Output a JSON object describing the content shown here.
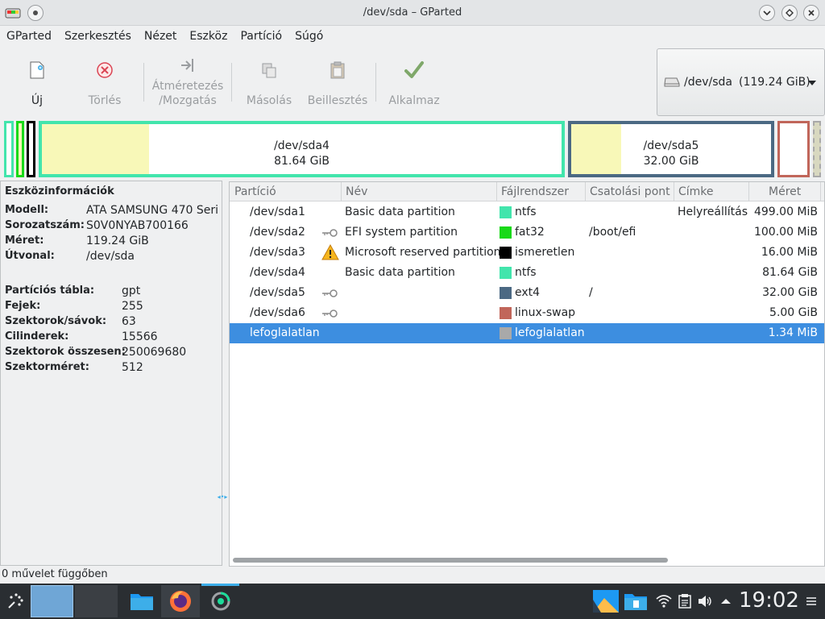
{
  "window": {
    "title": "/dev/sda – GParted"
  },
  "menu": [
    "GParted",
    "Szerkesztés",
    "Nézet",
    "Eszköz",
    "Partíció",
    "Súgó"
  ],
  "toolbar": {
    "new": "Új",
    "delete": "Törlés",
    "resize_line1": "Átméretezés",
    "resize_line2": "/Mozgatás",
    "copy": "Másolás",
    "paste": "Beillesztés",
    "apply": "Alkalmaz"
  },
  "device_selector": {
    "device": "/dev/sda",
    "size": "(119.24 GiB)"
  },
  "partition_map": {
    "sda4": {
      "name": "/dev/sda4",
      "size": "81.64 GiB"
    },
    "sda5": {
      "name": "/dev/sda5",
      "size": "32.00 GiB"
    }
  },
  "device_info": {
    "heading": "Eszközinformációk",
    "rows": [
      {
        "key": "Modell:",
        "value": "ATA SAMSUNG 470 Seri"
      },
      {
        "key": "Sorozatszám:",
        "value": "S0V0NYAB700166"
      },
      {
        "key": "Méret:",
        "value": "119.24 GiB"
      },
      {
        "key": "Útvonal:",
        "value": "/dev/sda"
      },
      {
        "key": "Partíciós tábla:",
        "value": "gpt"
      },
      {
        "key": "Fejek:",
        "value": "255"
      },
      {
        "key": "Szektorok/sávok:",
        "value": "63"
      },
      {
        "key": "Cilinderek:",
        "value": "15566"
      },
      {
        "key": "Szektorok összesen:",
        "value": "250069680"
      },
      {
        "key": "Szektorméret:",
        "value": "512"
      }
    ]
  },
  "table": {
    "headers": [
      "Partíció",
      "Név",
      "Fájlrendszer",
      "Csatolási pont",
      "Címke",
      "Méret"
    ],
    "rows": [
      {
        "partition": "/dev/sda1",
        "name": "Basic data partition",
        "fs": "ntfs",
        "fs_color": "#42e5ac",
        "mount": "",
        "label": "Helyreállítás",
        "size": "499.00 MiB",
        "icon": ""
      },
      {
        "partition": "/dev/sda2",
        "name": "EFI system partition",
        "fs": "fat32",
        "fs_color": "#18d918",
        "mount": "/boot/efi",
        "label": "",
        "size": "100.00 MiB",
        "icon": "key-icon"
      },
      {
        "partition": "/dev/sda3",
        "name": "Microsoft reserved partition",
        "fs": "ismeretlen",
        "fs_color": "#000000",
        "mount": "",
        "label": "",
        "size": "16.00 MiB",
        "icon": "warning-icon"
      },
      {
        "partition": "/dev/sda4",
        "name": "Basic data partition",
        "fs": "ntfs",
        "fs_color": "#42e5ac",
        "mount": "",
        "label": "",
        "size": "81.64 GiB",
        "icon": ""
      },
      {
        "partition": "/dev/sda5",
        "name": "",
        "fs": "ext4",
        "fs_color": "#4b6983",
        "mount": "/",
        "label": "",
        "size": "32.00 GiB",
        "icon": "key-icon"
      },
      {
        "partition": "/dev/sda6",
        "name": "",
        "fs": "linux-swap",
        "fs_color": "#c1665a",
        "mount": "",
        "label": "",
        "size": "5.00 GiB",
        "icon": "key-icon"
      },
      {
        "partition": "lefoglalatlan",
        "name": "",
        "fs": "lefoglalatlan",
        "fs_color": "#a9a9a9",
        "mount": "",
        "label": "",
        "size": "1.34 MiB",
        "icon": ""
      }
    ]
  },
  "status": "0 művelet függőben",
  "taskbar": {
    "clock": "19:02"
  },
  "colors": {
    "ntfs": "#42e5ac",
    "fat32": "#18d918",
    "ext4": "#4b6983",
    "linux_swap": "#c1665a",
    "used_space": "#f8f8b8",
    "selection": "#3d8ee0"
  }
}
